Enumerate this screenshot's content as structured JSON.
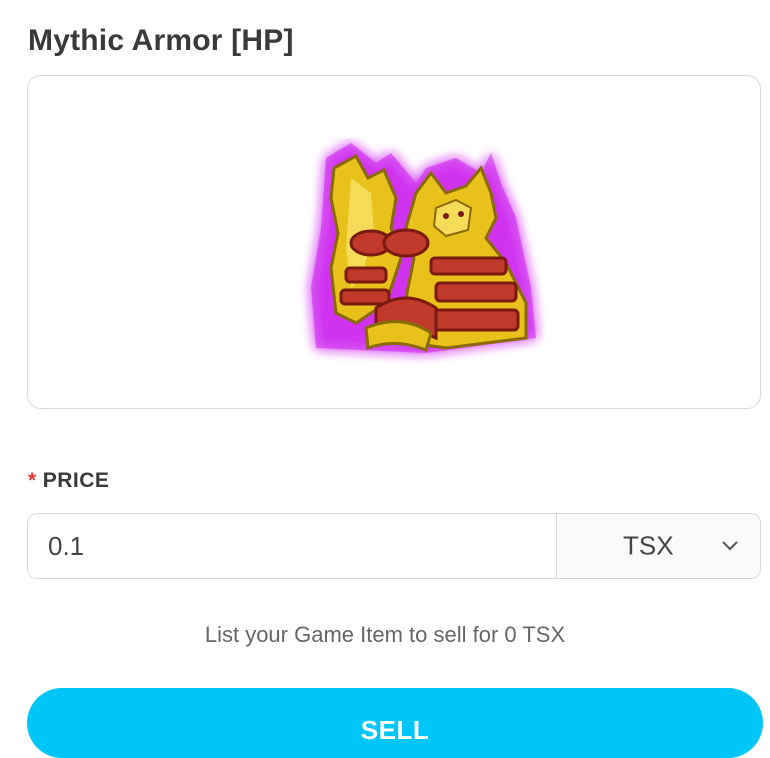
{
  "item": {
    "title": "Mythic Armor [HP]",
    "image_icon": "mythic-armor-sprite"
  },
  "price": {
    "label": "PRICE",
    "required_mark": "*",
    "value": "0.1",
    "currency": "TSX",
    "currency_options": [
      "TSX"
    ]
  },
  "hint": "List your Game Item to sell for 0 TSX",
  "sell_button": {
    "label": "SELL"
  },
  "colors": {
    "accent": "#00c6f7",
    "required": "#e53935",
    "armor_gold": "#e8c21a",
    "armor_red": "#c0392b",
    "armor_glow": "#c000e0"
  }
}
